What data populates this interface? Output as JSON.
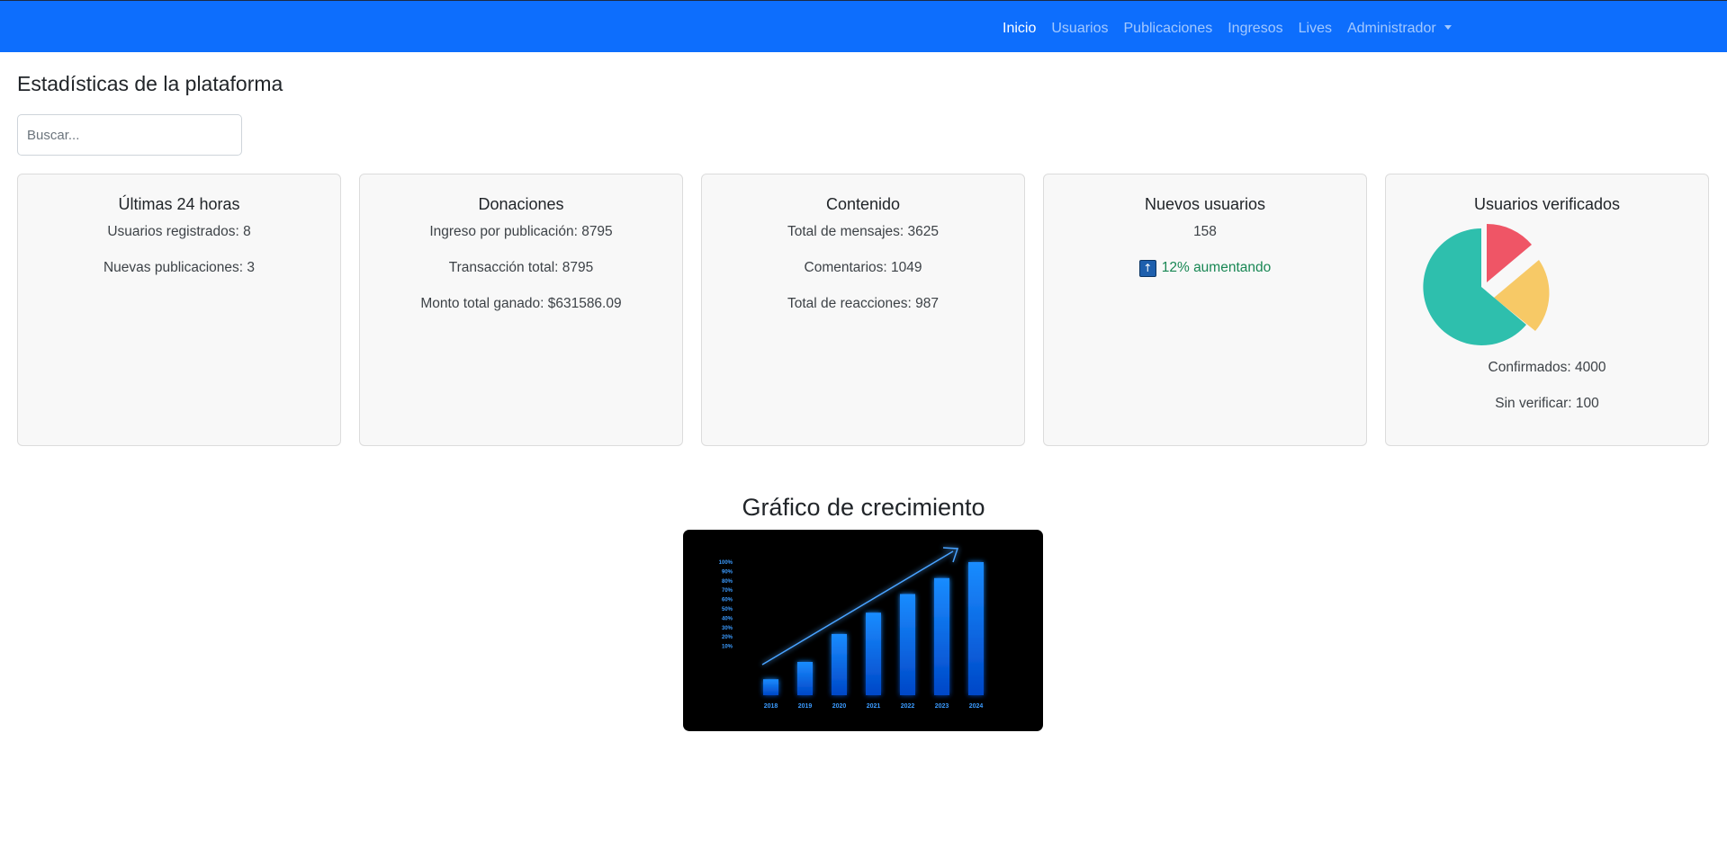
{
  "navbar": {
    "items": [
      {
        "label": "Inicio",
        "active": true
      },
      {
        "label": "Usuarios"
      },
      {
        "label": "Publicaciones"
      },
      {
        "label": "Ingresos"
      },
      {
        "label": "Lives"
      },
      {
        "label": "Administrador",
        "dropdown": true
      }
    ]
  },
  "page": {
    "title": "Estadísticas de la plataforma",
    "search_placeholder": "Buscar..."
  },
  "cards": {
    "last24": {
      "title": "Últimas 24 horas",
      "lines": [
        "Usuarios registrados: 8",
        "Nuevas publicaciones: 3"
      ]
    },
    "donations": {
      "title": "Donaciones",
      "lines": [
        "Ingreso por publicación: 8795",
        "Transacción total: 8795",
        "Monto total ganado: $631586.09"
      ]
    },
    "content": {
      "title": "Contenido",
      "lines": [
        "Total de mensajes: 3625",
        "Comentarios: 1049",
        "Total de reacciones: 987"
      ]
    },
    "new_users": {
      "title": "Nuevos usuarios",
      "count": "158",
      "trend_icon": "up-arrow-icon",
      "trend_text": "12% aumentando",
      "trend_color": "#198754"
    },
    "verified": {
      "title": "Usuarios verificados",
      "lines": [
        "Confirmados: 4000",
        "Sin verificar: 100"
      ],
      "pie_colors": [
        "#2ebfad",
        "#f7c966",
        "#ef5566"
      ]
    }
  },
  "growth": {
    "title": "Gráfico de crecimiento",
    "image": {
      "y_ticks": [
        "100%",
        "90%",
        "80%",
        "70%",
        "60%",
        "50%",
        "40%",
        "30%",
        "20%",
        "10%"
      ],
      "years": [
        "2018",
        "2019",
        "2020",
        "2021",
        "2022",
        "2023",
        "2024"
      ],
      "bar_levels": [
        0.12,
        0.25,
        0.46,
        0.62,
        0.76,
        0.88,
        1.0
      ],
      "bar_color": "#0a74ff"
    }
  }
}
